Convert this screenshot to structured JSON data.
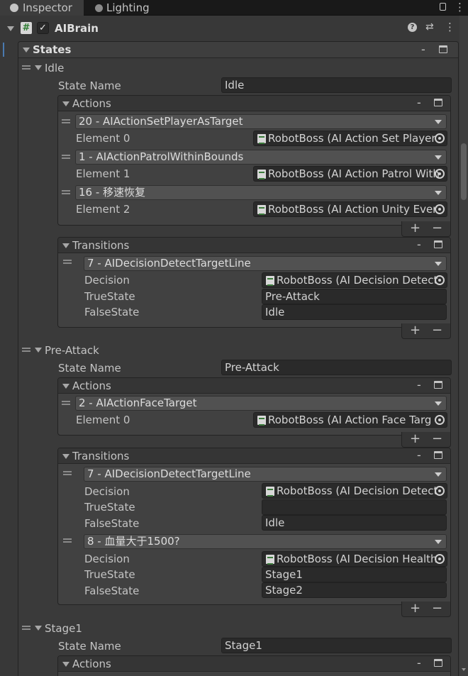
{
  "tabs": [
    {
      "label": "Inspector",
      "icon": "info-icon"
    },
    {
      "label": "Lighting",
      "icon": "lightbulb-icon"
    }
  ],
  "component": {
    "title": "AIBrain",
    "enabled": true
  },
  "states_header": "States",
  "labels": {
    "state_name": "State Name",
    "actions": "Actions",
    "transitions": "Transitions",
    "decision": "Decision",
    "true_state": "TrueState",
    "false_state": "FalseState"
  },
  "states": [
    {
      "name": "Idle",
      "state_name_value": "Idle",
      "actions": [
        {
          "type": "20 - AIActionSetPlayerAsTarget",
          "element_label": "Element 0",
          "element_value": "RobotBoss (AI Action Set Player"
        },
        {
          "type": "1 - AIActionPatrolWithinBounds",
          "element_label": "Element 1",
          "element_value": "RobotBoss (AI Action Patrol With"
        },
        {
          "type": "16 - 移速恢复",
          "element_label": "Element 2",
          "element_value": "RobotBoss (AI Action Unity Ever"
        }
      ],
      "transitions": [
        {
          "type": "7 - AIDecisionDetectTargetLine",
          "decision": "RobotBoss (AI Decision Detect",
          "true_state": "Pre-Attack",
          "false_state": "Idle"
        }
      ]
    },
    {
      "name": "Pre-Attack",
      "state_name_value": "Pre-Attack",
      "actions": [
        {
          "type": "2 - AIActionFaceTarget",
          "element_label": "Element 0",
          "element_value": "RobotBoss (AI Action Face Targ"
        }
      ],
      "transitions": [
        {
          "type": "7 - AIDecisionDetectTargetLine",
          "decision": "RobotBoss (AI Decision Detect",
          "true_state": "",
          "false_state": "Idle"
        },
        {
          "type": "8 - 血量大于1500?",
          "decision": "RobotBoss (AI Decision Health",
          "true_state": "Stage1",
          "false_state": "Stage2"
        }
      ]
    },
    {
      "name": "Stage1",
      "state_name_value": "Stage1"
    }
  ]
}
